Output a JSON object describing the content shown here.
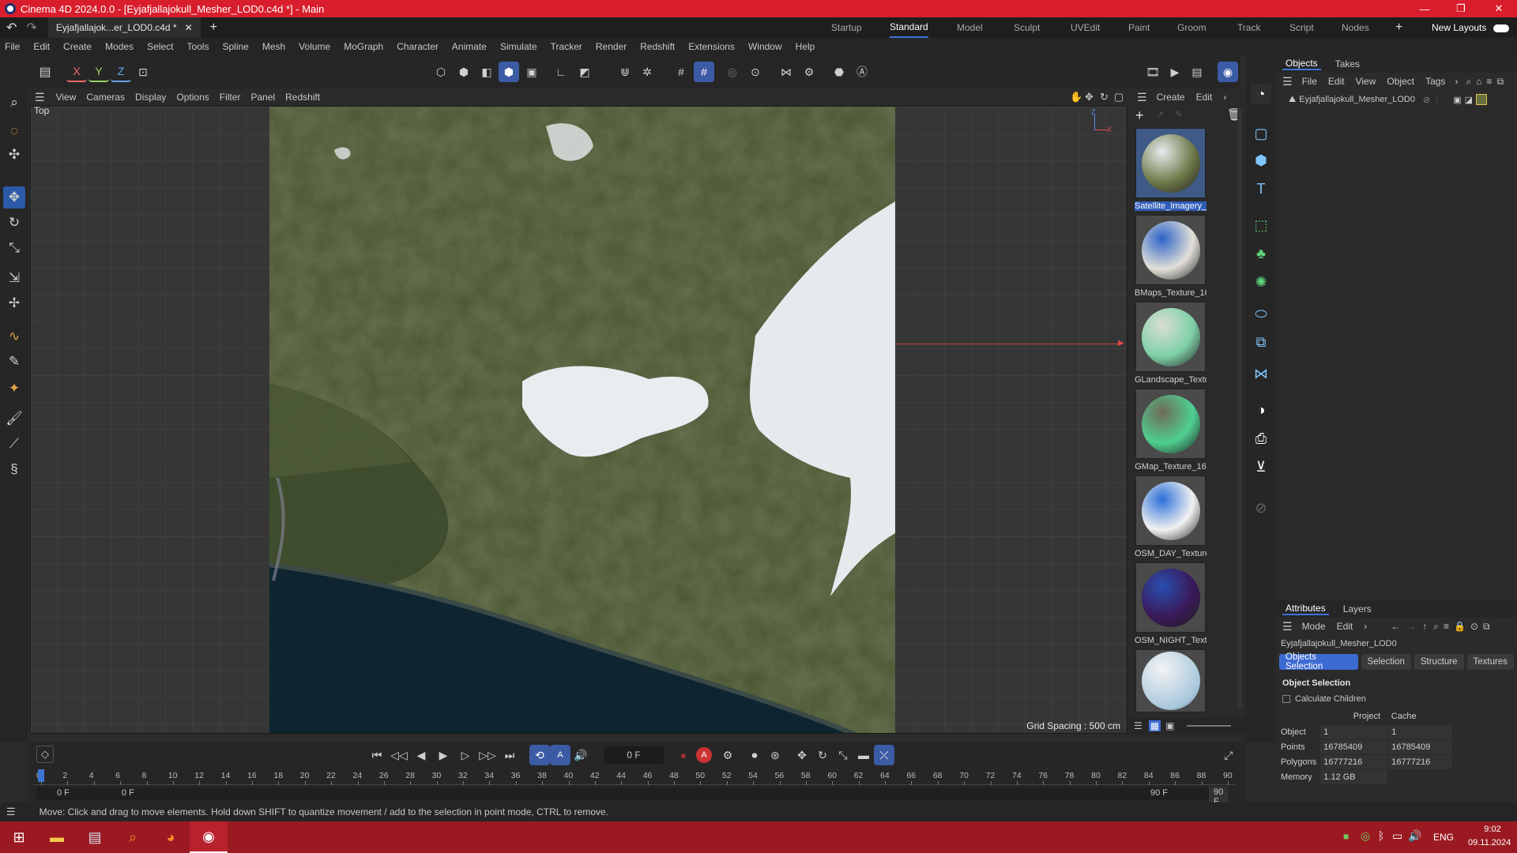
{
  "window": {
    "title": "Cinema 4D 2024.0.0 - [Eyjafjallajokull_Mesher_LOD0.c4d *] - Main"
  },
  "tabrow": {
    "doc_tab": "Eyjafjallajok...er_LOD0.c4d *",
    "layouts": [
      "Startup",
      "Standard",
      "Model",
      "Sculpt",
      "UVEdit",
      "Paint",
      "Groom",
      "Track",
      "Script",
      "Nodes"
    ],
    "active_layout": "Standard",
    "new_layouts": "New Layouts"
  },
  "menubar": [
    "File",
    "Edit",
    "Create",
    "Modes",
    "Select",
    "Tools",
    "Spline",
    "Mesh",
    "Volume",
    "MoGraph",
    "Character",
    "Animate",
    "Simulate",
    "Tracker",
    "Render",
    "Redshift",
    "Extensions",
    "Window",
    "Help"
  ],
  "toolbar": {
    "axis_x": "X",
    "axis_y": "Y",
    "axis_z": "Z"
  },
  "viewport": {
    "menu": [
      "View",
      "Cameras",
      "Display",
      "Options",
      "Filter",
      "Panel",
      "Redshift"
    ],
    "view_name": "Top",
    "grid_spacing": "Grid Spacing : 500 cm",
    "axis_z": "Z",
    "axis_x": "X"
  },
  "material_browser": {
    "menu": [
      "Create",
      "Edit"
    ],
    "materials": [
      {
        "name": "Satellite_Imagery_",
        "colors": [
          "#6f7a4a",
          "#e8ecef"
        ]
      },
      {
        "name": "BMaps_Texture_16",
        "colors": [
          "#e2e0d8",
          "#2d63c8"
        ]
      },
      {
        "name": "GLandscape_Textu",
        "colors": [
          "#7fd1a8",
          "#d9ddd4"
        ]
      },
      {
        "name": "GMap_Texture_16",
        "colors": [
          "#4fcf90",
          "#6f6a5a"
        ]
      },
      {
        "name": "OSM_DAY_Texture",
        "colors": [
          "#f2f2f2",
          "#2b6fd8"
        ]
      },
      {
        "name": "OSM_NIGHT_Text",
        "colors": [
          "#3a1a5a",
          "#2a4fb0"
        ]
      }
    ]
  },
  "objects_panel": {
    "tabs": [
      "Objects",
      "Takes"
    ],
    "menu": [
      "File",
      "Edit",
      "View",
      "Object",
      "Tags"
    ],
    "object_name": "Eyjafjallajokull_Mesher_LOD0"
  },
  "attributes": {
    "tabs": [
      "Attributes",
      "Layers"
    ],
    "menu": [
      "Mode",
      "Edit"
    ],
    "object_name": "Eyjafjallajokull_Mesher_LOD0",
    "subtabs": [
      "Objects Selection",
      "Selection",
      "Structure",
      "Textures"
    ],
    "section": "Object Selection",
    "calc_children": "Calculate Children",
    "col_project": "Project",
    "col_cache": "Cache",
    "rows": [
      {
        "label": "Object",
        "project": "1",
        "cache": "1"
      },
      {
        "label": "Points",
        "project": "16785409",
        "cache": "16785409"
      },
      {
        "label": "Polygons",
        "project": "16777216",
        "cache": "16777216"
      },
      {
        "label": "Memory",
        "project": "1.12 GB",
        "cache": ""
      }
    ]
  },
  "timeline": {
    "current_frame": "0 F",
    "ticks": [
      "0",
      "2",
      "4",
      "6",
      "8",
      "10",
      "12",
      "14",
      "16",
      "18",
      "20",
      "22",
      "24",
      "26",
      "28",
      "30",
      "32",
      "34",
      "36",
      "38",
      "40",
      "42",
      "44",
      "46",
      "48",
      "50",
      "52",
      "54",
      "56",
      "58",
      "60",
      "62",
      "64",
      "66",
      "68",
      "70",
      "72",
      "74",
      "76",
      "78",
      "80",
      "82",
      "84",
      "86",
      "88",
      "90"
    ],
    "start_a": "0 F",
    "start_b": "0 F",
    "end_a": "90 F",
    "end_b": "90 F"
  },
  "status": {
    "text": "Move: Click and drag to move elements. Hold down SHIFT to quantize movement / add to the selection in point mode, CTRL to remove."
  },
  "taskbar": {
    "lang": "ENG",
    "time": "9:02",
    "date": "09.11.2024"
  }
}
